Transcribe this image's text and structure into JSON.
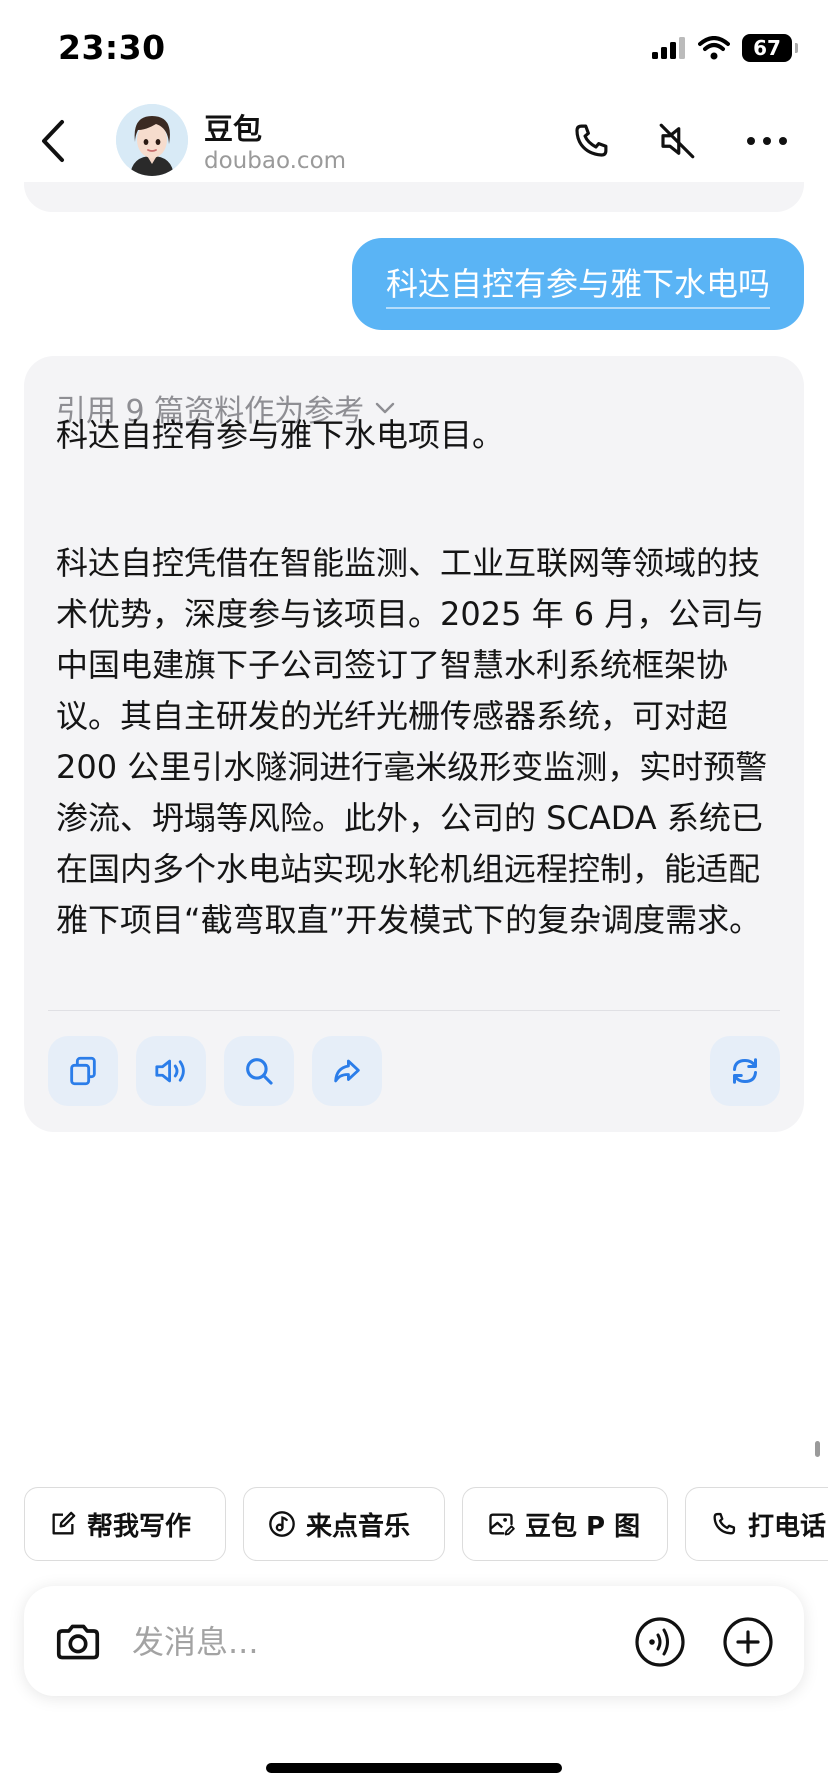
{
  "status_bar": {
    "time": "23:30",
    "battery": "67"
  },
  "header": {
    "title": "豆包",
    "subtitle": "doubao.com",
    "icons": [
      "back-icon",
      "phone-icon",
      "mute-icon",
      "more-icon"
    ]
  },
  "chat": {
    "user_message": "科达自控有参与雅下水电吗",
    "reply": {
      "references": "引用 9 篇资料作为参考",
      "paragraphs": [
        "科达自控有参与雅下水电项目。",
        "科达自控凭借在智能监测、工业互联网等领域的技术优势，深度参与该项目。2025 年 6 月，公司与中国电建旗下子公司签订了智慧水利系统框架协议。其自主研发的光纤光栅传感器系统，可对超 200 公里引水隧洞进行毫米级形变监测，实时预警渗流、坍塌等风险。此外，公司的 SCADA 系统已在国内多个水电站实现水轮机组远程控制，能适配雅下项目“截弯取直”开发模式下的复杂调度需求。"
      ],
      "actions": [
        "copy-icon",
        "speaker-icon",
        "search-icon",
        "share-icon",
        "refresh-icon"
      ]
    }
  },
  "quick_actions": [
    {
      "label": "帮我写作",
      "icon": "edit-icon"
    },
    {
      "label": "来点音乐",
      "icon": "music-icon"
    },
    {
      "label": "豆包 P 图",
      "icon": "image-edit-icon"
    },
    {
      "label": "打电话",
      "icon": "phone-icon"
    }
  ],
  "input": {
    "placeholder": "发消息..."
  },
  "colors": {
    "accent": "#2b7de9",
    "user_bubble": "#5ab4f5",
    "card_bg": "#f4f4f6"
  }
}
